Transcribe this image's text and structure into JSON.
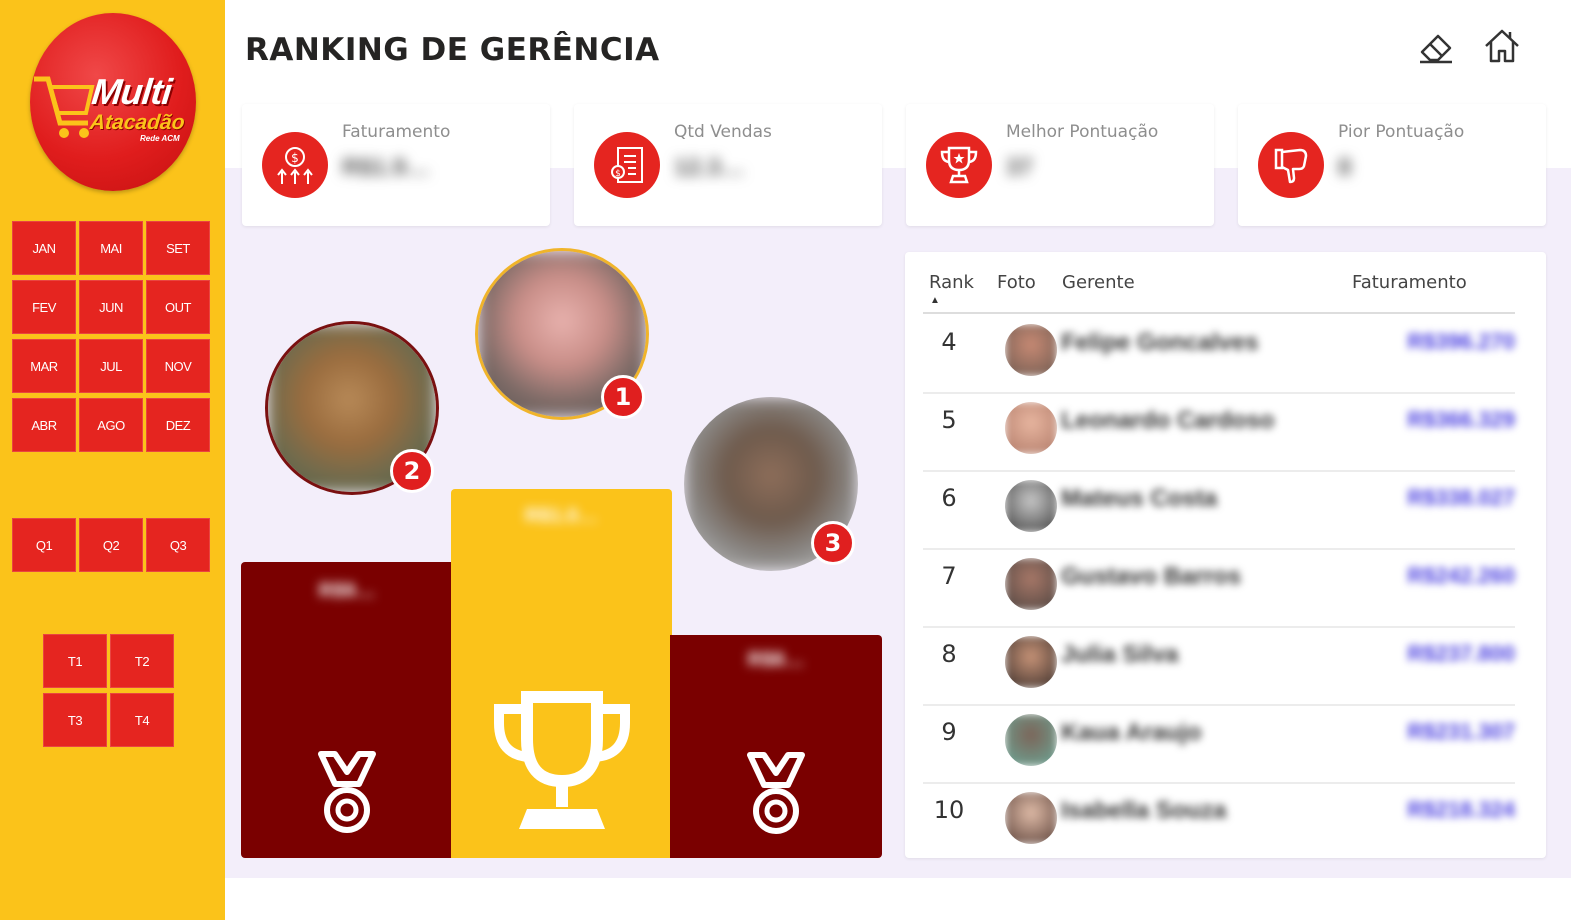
{
  "header": {
    "title": "RANKING DE GERÊNCIA"
  },
  "logo": {
    "line1": "Multi",
    "line2": "Atacadão",
    "line3": "Rede ACM"
  },
  "months": [
    "JAN",
    "MAI",
    "SET",
    "FEV",
    "JUN",
    "OUT",
    "MAR",
    "JUL",
    "NOV",
    "ABR",
    "AGO",
    "DEZ"
  ],
  "quadrimesters": [
    "Q1",
    "Q2",
    "Q3"
  ],
  "trimesters": [
    "T1",
    "T2",
    "T3",
    "T4"
  ],
  "kpis": [
    {
      "label": "Faturamento",
      "value": "R$1.9…",
      "icon": "money-growth-icon"
    },
    {
      "label": "Qtd Vendas",
      "value": "12.3…",
      "icon": "receipt-icon"
    },
    {
      "label": "Melhor Pontuação",
      "value": "37",
      "icon": "trophy-icon"
    },
    {
      "label": "Pior Pontuação",
      "value": "8",
      "icon": "thumbs-down-icon"
    }
  ],
  "podium": {
    "first": {
      "badge": "1",
      "value": "R$1.0…"
    },
    "second": {
      "badge": "2",
      "value": "R$9…"
    },
    "third": {
      "badge": "3",
      "value": "R$8…"
    }
  },
  "table": {
    "columns": [
      "Rank",
      "Foto",
      "Gerente",
      "Faturamento"
    ],
    "sort_indicator": "▲",
    "rows": [
      {
        "rank": "4",
        "gerente": "Felipe Goncalves",
        "faturamento": "R$396.270"
      },
      {
        "rank": "5",
        "gerente": "Leonardo Cardoso",
        "faturamento": "R$366.329"
      },
      {
        "rank": "6",
        "gerente": "Mateus Costa",
        "faturamento": "R$338.027"
      },
      {
        "rank": "7",
        "gerente": "Gustavo Barros",
        "faturamento": "R$242.260"
      },
      {
        "rank": "8",
        "gerente": "Julia Silva",
        "faturamento": "R$237.800"
      },
      {
        "rank": "9",
        "gerente": "Kaua Araujo",
        "faturamento": "R$231.307"
      },
      {
        "rank": "10",
        "gerente": "Isabella Souza",
        "faturamento": "R$218.324"
      }
    ]
  },
  "colors": {
    "sidebar": "#fbc31a",
    "accent_red": "#e52520",
    "podium_dark": "#7a0000",
    "podium_gold": "#fbc31a",
    "background": "#f3eefa"
  }
}
